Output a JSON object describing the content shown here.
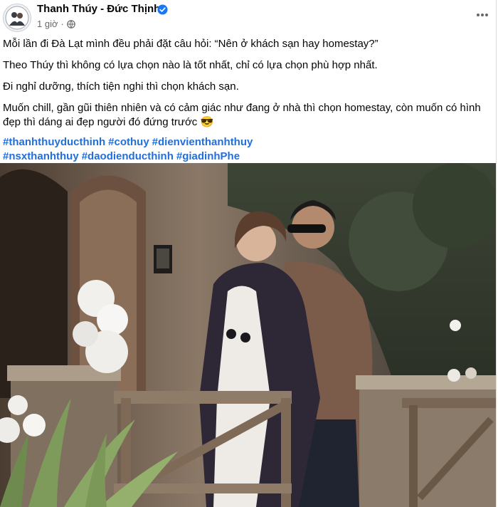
{
  "post": {
    "author": "Thanh Thúy - Đức Thịnh",
    "time": "1 giờ",
    "separator": "·",
    "verified_icon": "verified-badge-icon",
    "privacy_icon": "globe-icon",
    "more_icon": "more-options-icon",
    "paragraphs": [
      "Mỗi lần đi Đà Lạt mình đều phải đặt câu hỏi: “Nên ở khách sạn hay homestay?”",
      "Theo Thúy thì không có lựa chọn nào là tốt nhất, chỉ có lựa chọn phù hợp nhất.",
      "Đi nghỉ dưỡng, thích tiện nghi thì chọn khách sạn.",
      "Muốn chill, gần gũi thiên nhiên và có cảm giác như đang ở nhà thì chọn homestay, còn muốn có hình đẹp thì dáng ai đẹp người đó đứng trước 😎"
    ],
    "hashtags_line1": [
      "#thanhthuyducthinh",
      "#cothuy",
      "#dienvienthanhthuy"
    ],
    "hashtags_line2": [
      "#nsxthanhthuy",
      "#daodienducthinh",
      "#giadinhPhe"
    ],
    "link_color": "#216fdb",
    "photo_description_icon": "couple-photo"
  }
}
